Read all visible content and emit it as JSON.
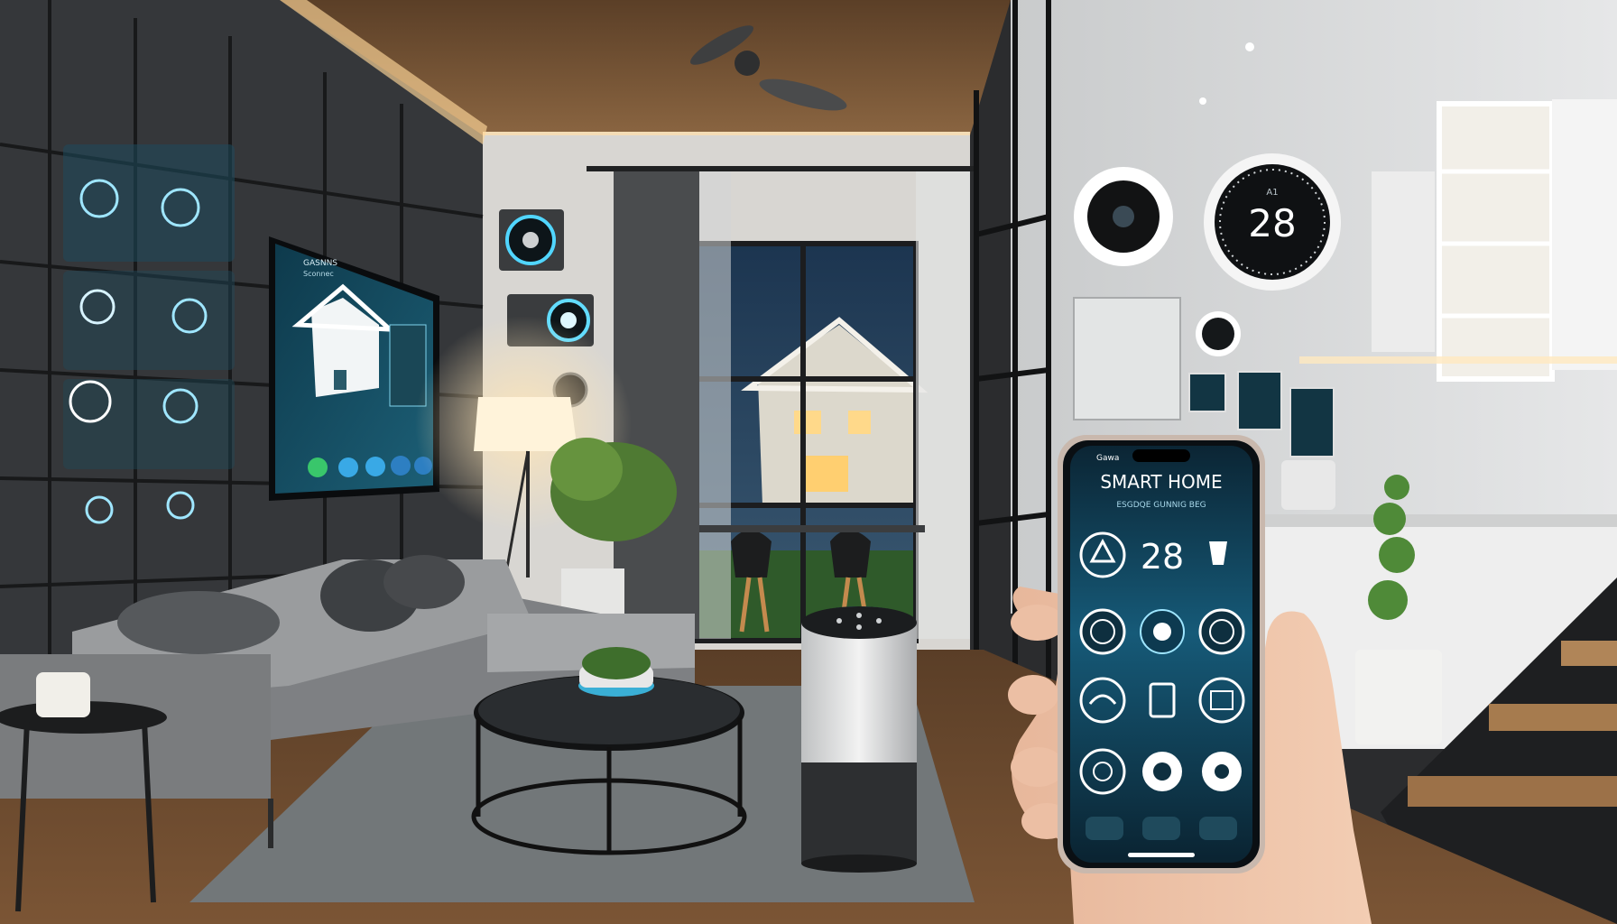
{
  "tv_panel": {
    "caption_line1": "GASNNS",
    "caption_line2": "Sconnec"
  },
  "thermostat": {
    "value": "28",
    "small_label": "A1"
  },
  "phone": {
    "status_left": "Gawa",
    "title": "SMART HOME",
    "subtitle": "ESGDQE GUNNIG BEG",
    "temperature": "28"
  },
  "colors": {
    "accent_glow": "#3fd0ff",
    "ceiling_wood": "#7a5a3c",
    "floor_wood": "#6b4a2e",
    "wall_panel": "#3a3b3c",
    "sofa": "#8a8c8e",
    "kitchen_cabinet": "#e9eaea",
    "phone_screen": "#0f3346"
  },
  "icons": [
    "lock-icon",
    "wifi-icon",
    "camera-icon",
    "lightbulb-icon",
    "thermostat-icon",
    "speaker-icon",
    "home-icon",
    "shield-icon",
    "power-icon",
    "settings-icon"
  ]
}
